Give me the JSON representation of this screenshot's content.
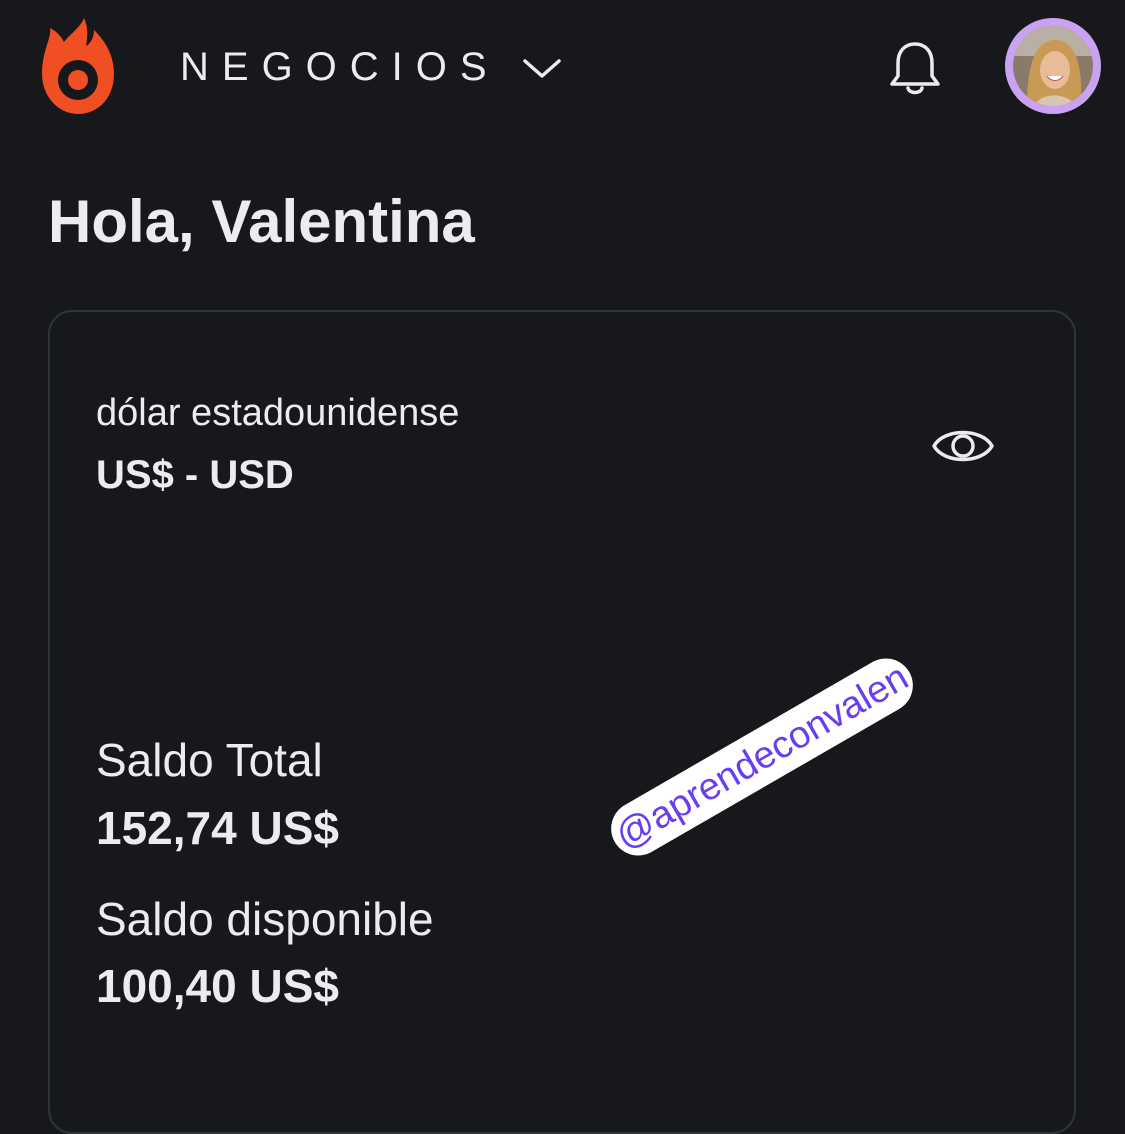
{
  "header": {
    "workspace_label": "NEGOCIOS",
    "brand_color": "#f04e23",
    "icons": {
      "logo": "flame-logo-icon",
      "workspace_toggle": "chevron-down-icon",
      "notifications": "bell-icon",
      "avatar": "user-avatar"
    },
    "avatar_ring_color": "#c9a3f2"
  },
  "greeting": "Hola, Valentina",
  "balance_card": {
    "currency_name": "dólar estadounidense",
    "currency_code": "US$ - USD",
    "visibility_icon": "eye-icon",
    "total_label": "Saldo Total",
    "total_value": "152,74 US$",
    "available_label": "Saldo disponible",
    "available_value": "100,40 US$"
  },
  "overlay": {
    "sticker_text": "@aprendeconvalen",
    "sticker_color": "#6a3df0"
  }
}
